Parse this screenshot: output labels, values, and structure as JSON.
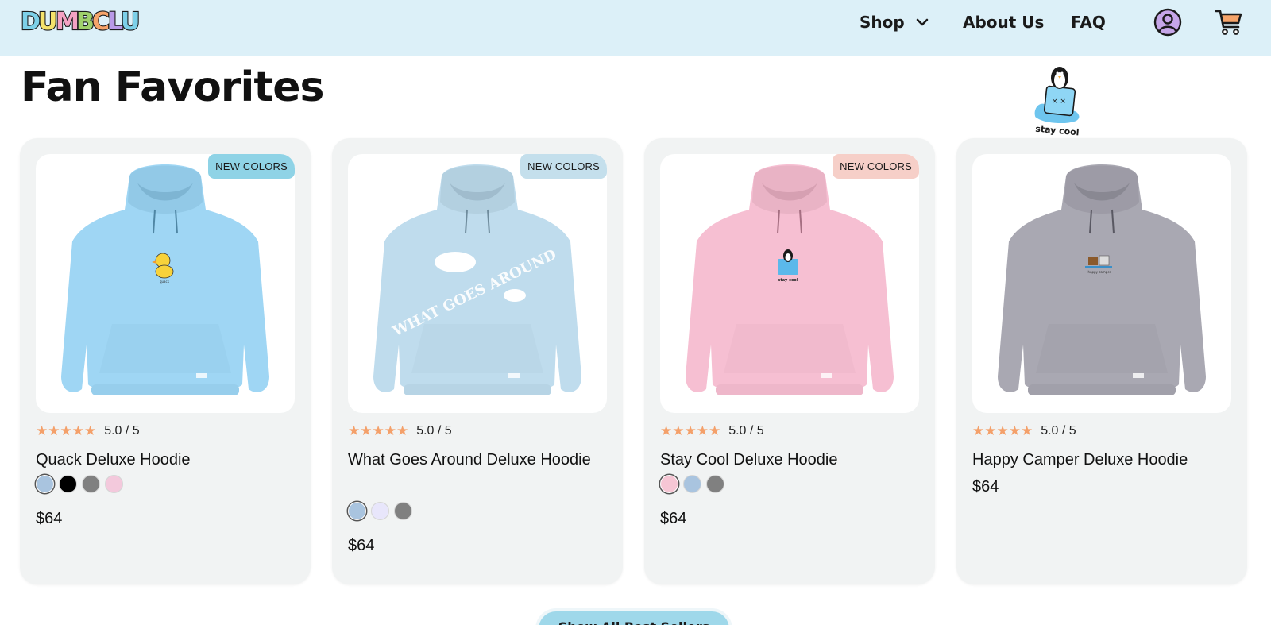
{
  "brand": {
    "logo_text": "DUMBCLUB"
  },
  "nav": {
    "shop": "Shop",
    "about": "About Us",
    "faq": "FAQ"
  },
  "section": {
    "title": "Fan Favorites"
  },
  "sticker": {
    "caption": "stay cool"
  },
  "products": [
    {
      "badge": "NEW COLORS",
      "badge_color": "#8fd3e6",
      "stars": "★★★★★",
      "rating": "5.0 / 5",
      "name": "Quack Deluxe Hoodie",
      "hoodie_color": "#9fd6f4",
      "print_text": "quack",
      "swatches": [
        "#a9c4df",
        "#000000",
        "#808080",
        "#f3c9dc"
      ],
      "price": "$64"
    },
    {
      "badge": "NEW COLORS",
      "badge_color": "#c4dfec",
      "stars": "★★★★★",
      "rating": "5.0 / 5",
      "name": "What Goes Around Deluxe Hoodie",
      "hoodie_color": "#bfdced",
      "print_text": "WHAT GOES AROUND",
      "swatches": [
        "#a9c4df",
        "#e8e6fb",
        "#808080"
      ],
      "price": "$64"
    },
    {
      "badge": "NEW COLORS",
      "badge_color": "#f6cfc8",
      "stars": "★★★★★",
      "rating": "5.0 / 5",
      "name": "Stay Cool Deluxe Hoodie",
      "hoodie_color": "#f6bfd2",
      "print_text": "stay cool",
      "swatches": [
        "#f6c6d4",
        "#a9c4df",
        "#808080"
      ],
      "price": "$64"
    },
    {
      "badge": "",
      "badge_color": "",
      "stars": "★★★★★",
      "rating": "5.0 / 5",
      "name": "Happy Camper Deluxe Hoodie",
      "hoodie_color": "#a9a8b2",
      "print_text": "happy camper",
      "swatches": [],
      "price": "$64"
    }
  ],
  "show_all": {
    "label": "Show All Best Sellers"
  }
}
